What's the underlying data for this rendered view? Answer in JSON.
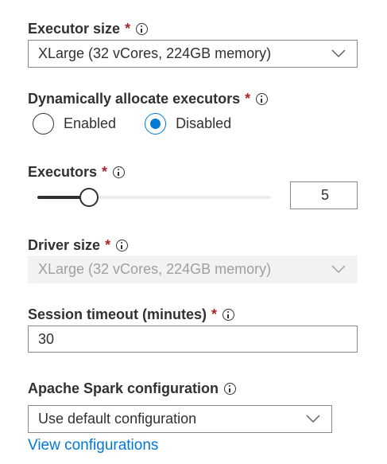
{
  "executor_size": {
    "label": "Executor size",
    "required": "*",
    "value": "XLarge (32 vCores, 224GB memory)"
  },
  "dynamic_allocation": {
    "label": "Dynamically allocate executors",
    "required": "*",
    "options": [
      {
        "label": "Enabled",
        "checked": false
      },
      {
        "label": "Disabled",
        "checked": true
      }
    ]
  },
  "executors": {
    "label": "Executors",
    "required": "*",
    "value": "5",
    "slider_level": 0.22
  },
  "driver_size": {
    "label": "Driver size",
    "required": "*",
    "value": "XLarge (32 vCores, 224GB memory)",
    "disabled": true
  },
  "session_timeout": {
    "label": "Session timeout (minutes)",
    "required": "*",
    "value": "30"
  },
  "spark_config": {
    "label": "Apache Spark configuration",
    "value": "Use default configuration",
    "link": "View configurations"
  },
  "colors": {
    "accent": "#0078d4",
    "required": "#a4262c",
    "text": "#323130",
    "disabled_bg": "#f3f2f1",
    "disabled_text": "#a19f9d"
  },
  "icons": [
    "info-icon",
    "chevron-down-icon"
  ]
}
